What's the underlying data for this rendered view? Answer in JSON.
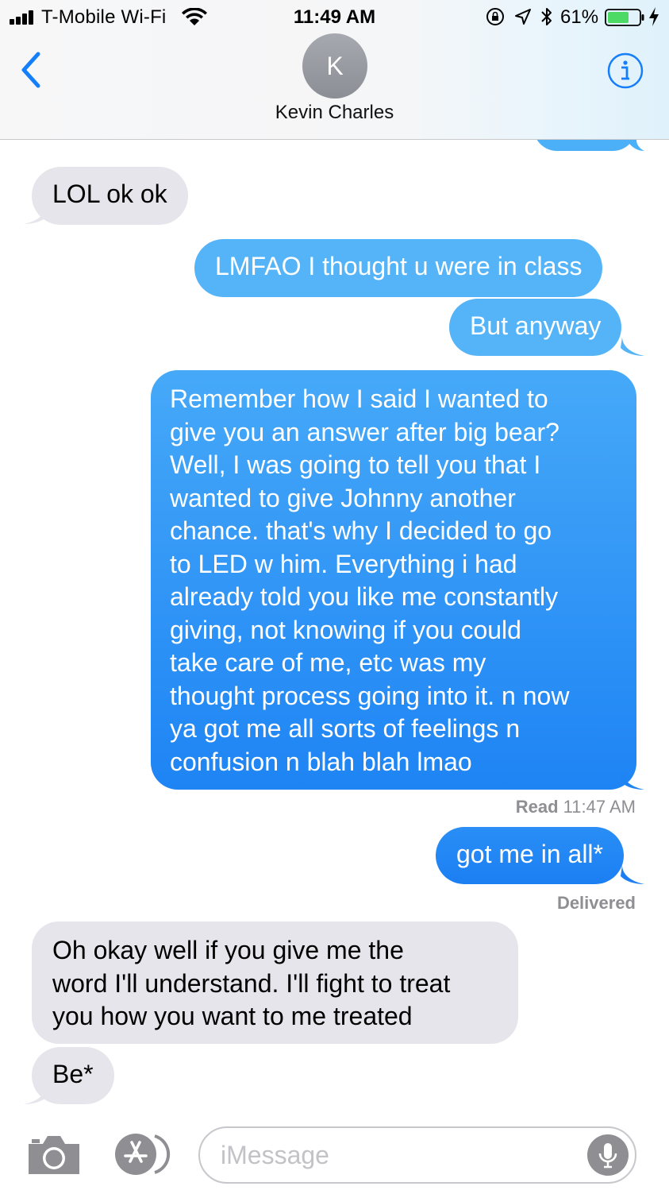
{
  "status_bar": {
    "carrier": "T-Mobile Wi-Fi",
    "time": "11:49 AM",
    "battery": "61%",
    "icons": [
      "signal-icon",
      "wifi-icon",
      "orientation-lock-icon",
      "location-icon",
      "bluetooth-icon",
      "battery-icon",
      "charging-bolt-icon"
    ]
  },
  "header": {
    "back_icon": "chevron-left-icon",
    "avatar_initial": "K",
    "contact_name": "Kevin Charles",
    "info_icon": "info-icon"
  },
  "messages": [
    {
      "direction": "incoming",
      "text": "LOL ok ok"
    },
    {
      "direction": "outgoing",
      "text": "LMFAO I thought u were in class"
    },
    {
      "direction": "outgoing",
      "text": "But anyway"
    },
    {
      "direction": "outgoing",
      "lines": [
        "Remember how I said I wanted to",
        "give you an answer after big bear?",
        "Well, I was going to tell you that I",
        "wanted to give Johnny another",
        "chance. that's why I decided to go",
        "to LED w him. Everything i had",
        "already told you like me constantly",
        "giving, not knowing if you could",
        "take care of me, etc was my",
        "thought process going into it. n now",
        "ya got me all sorts of feelings n",
        "confusion n blah blah lmao"
      ]
    },
    {
      "direction": "outgoing",
      "text": "got me in all*"
    },
    {
      "direction": "incoming",
      "lines": [
        "Oh okay well if you give me the",
        "word I'll understand. I'll fight to treat",
        "you how you want to me treated"
      ]
    },
    {
      "direction": "incoming",
      "text": "Be*"
    }
  ],
  "receipts": {
    "read_label": "Read",
    "read_time": "11:47 AM",
    "delivered": "Delivered"
  },
  "input_bar": {
    "placeholder": "iMessage",
    "camera_icon": "camera-icon",
    "apps_icon": "app-store-icon",
    "mic_icon": "microphone-icon"
  },
  "colors": {
    "outgoing_bubble": "#1e84f4",
    "incoming_bubble": "#e6e5eb",
    "accent": "#147efb"
  }
}
